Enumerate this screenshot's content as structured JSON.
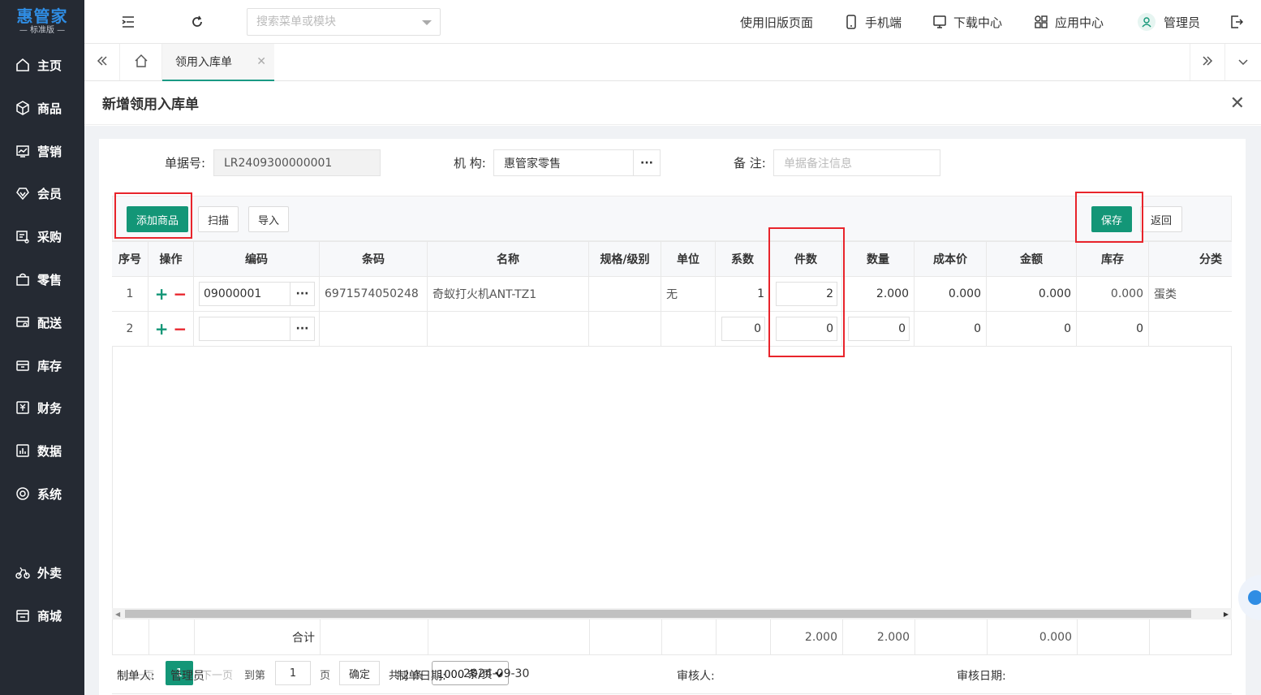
{
  "brand": {
    "name": "惠管家",
    "edition": "— 标准版 —",
    "color": "#2f8de4"
  },
  "sidebar": {
    "items": [
      {
        "label": "主页",
        "icon": "home-icon"
      },
      {
        "label": "商品",
        "icon": "cube-icon"
      },
      {
        "label": "营销",
        "icon": "chart-icon"
      },
      {
        "label": "会员",
        "icon": "diamond-icon"
      },
      {
        "label": "采购",
        "icon": "purchase-icon"
      },
      {
        "label": "零售",
        "icon": "bag-icon"
      },
      {
        "label": "配送",
        "icon": "truck-icon"
      },
      {
        "label": "库存",
        "icon": "warehouse-icon"
      },
      {
        "label": "财务",
        "icon": "finance-icon"
      },
      {
        "label": "数据",
        "icon": "data-icon"
      },
      {
        "label": "系统",
        "icon": "settings-icon"
      },
      {
        "label": "外卖",
        "icon": "bike-icon"
      },
      {
        "label": "商城",
        "icon": "shop-icon"
      }
    ]
  },
  "header": {
    "search_placeholder": "搜索菜单或模块",
    "links": [
      "使用旧版页面",
      "手机端",
      "下载中心",
      "应用中心",
      "管理员"
    ]
  },
  "tabs": {
    "active": "领用入库单"
  },
  "page": {
    "title": "新增领用入库单",
    "form": {
      "doc_no_label": "单据号:",
      "doc_no": "LR2409300000001",
      "org_label": "机 构:",
      "org": "惠管家零售",
      "remark_label": "备 注:",
      "remark_placeholder": "单据备注信息"
    },
    "toolbar": {
      "add": "添加商品",
      "scan": "扫描",
      "import": "导入",
      "save": "保存",
      "back": "返回"
    },
    "table": {
      "columns": [
        "序号",
        "操作",
        "编码",
        "条码",
        "名称",
        "规格/级别",
        "单位",
        "系数",
        "件数",
        "数量",
        "成本价",
        "金额",
        "库存",
        "分类"
      ],
      "rows": [
        {
          "no": "1",
          "code": "09000001",
          "barcode": "6971574050248",
          "name": "奇蚁打火机ANT-TZ1",
          "spec": "",
          "unit": "无",
          "factor": "1",
          "pieces": "2",
          "qty": "2.000",
          "cost": "0.000",
          "amount": "0.000",
          "stock": "0.000",
          "category": "蛋类"
        },
        {
          "no": "2",
          "code": "",
          "barcode": "",
          "name": "",
          "spec": "",
          "unit": "",
          "factor": "0",
          "pieces": "0",
          "qty": "0",
          "cost": "0",
          "amount": "0",
          "stock": "0",
          "category": ""
        }
      ],
      "total": {
        "label": "合计",
        "pieces": "2.000",
        "qty": "2.000",
        "amount": "0.000"
      }
    },
    "pager": {
      "prev": "上一页",
      "current": "1",
      "next": "下一页",
      "goto": "到第",
      "goto_value": "1",
      "page_unit": "页",
      "confirm": "确定",
      "total": "共 2 条",
      "page_size": "1000 条/页"
    },
    "footer": {
      "maker_label": "制单人:",
      "maker": "管理员",
      "date_label": "制单日期:",
      "date": "2024-09-30",
      "auditor_label": "审核人:",
      "audit_date_label": "审核日期:"
    }
  },
  "colors": {
    "primary": "#139677",
    "highlight": "#e8242b",
    "sidebar": "#252a33"
  }
}
